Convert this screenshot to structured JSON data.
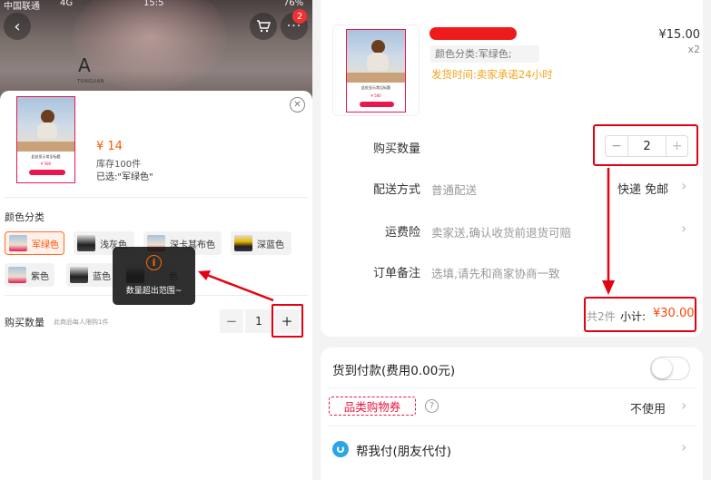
{
  "left": {
    "status_bar": {
      "carrier": "中国联通",
      "network": "4G",
      "time": "15:5",
      "battery": "76%"
    },
    "cart_badge": "2",
    "shop_logo": "A",
    "shop_logo_sub": "TONGLIAN",
    "product": {
      "card_text": "此处显示常见标题",
      "card_price": "¥ 580",
      "price": "¥ 14",
      "stock": "库存100件",
      "selected": "已选:\"军绿色\""
    },
    "color_section_label": "颜色分类",
    "color_options": [
      {
        "label": "军绿色",
        "selected": true
      },
      {
        "label": "浅灰色",
        "selected": false
      },
      {
        "label": "深卡其布色",
        "selected": false
      },
      {
        "label": "深蓝色",
        "selected": false
      },
      {
        "label": "紫色",
        "selected": false
      },
      {
        "label": "蓝色",
        "selected": false
      },
      {
        "label": "色",
        "selected": false
      }
    ],
    "toast": {
      "icon": "i",
      "text": "数量超出范围~"
    },
    "quantity": {
      "label": "购买数量",
      "limit": "此商品每人限购1件",
      "minus": "−",
      "value": "1",
      "plus": "+"
    }
  },
  "right": {
    "product": {
      "sku": "颜色分类:军绿色;",
      "ship_time": "发货时间:卖家承诺24小时",
      "unit_price": "¥15.00",
      "count": "x2"
    },
    "rows": {
      "quantity_label": "购买数量",
      "stepper_minus": "−",
      "stepper_value": "2",
      "stepper_plus": "+",
      "delivery_label": "配送方式",
      "delivery_value": "普通配送",
      "delivery_right": "快递 免邮",
      "insurance_label": "运费险",
      "insurance_value": "卖家送,确认收货前退货可赔",
      "note_label": "订单备注",
      "note_placeholder": "选填,请先和商家协商一致"
    },
    "total": {
      "count": "共2件",
      "label": "小计:",
      "amount": "¥30.00"
    },
    "payment": {
      "cod_label": "货到付款(费用0.00元)",
      "cod_enabled": false,
      "coupon_label": "品类购物券",
      "coupon_value": "不使用",
      "friend_pay_label": "帮我付(朋友代付)"
    }
  },
  "colors": {
    "accent_red": "#e60012",
    "price_orange": "#ff4400",
    "brand_pink": "#e8174f",
    "ship_yellow": "#f2a41c"
  },
  "icons": [
    "back-icon",
    "cart-icon",
    "more-icon",
    "close-icon",
    "info-icon",
    "chevron-right-icon",
    "help-icon",
    "friend-pay-icon"
  ]
}
